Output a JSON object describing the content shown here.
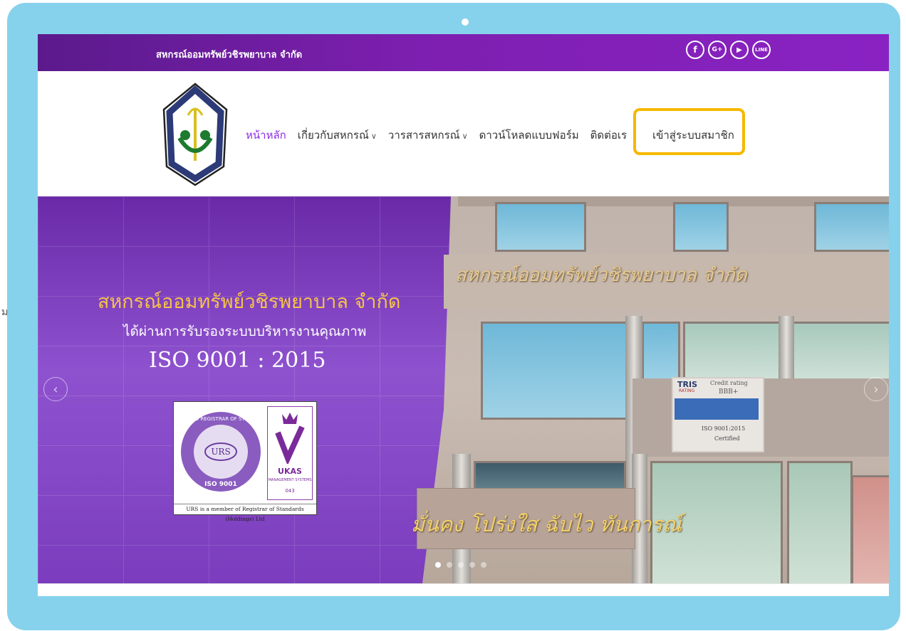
{
  "stray_char": "ม",
  "topbar": {
    "site_name": "สหกรณ์ออมทรัพย์วชิรพยาบาล จำกัด",
    "social_icons": [
      {
        "name": "facebook-icon",
        "glyph": "f"
      },
      {
        "name": "google-plus-icon",
        "glyph": "G+"
      },
      {
        "name": "youtube-icon",
        "glyph": "▶"
      },
      {
        "name": "line-icon",
        "glyph": "LINE"
      }
    ]
  },
  "nav": {
    "items": [
      {
        "label": "หน้าหลัก",
        "active": true,
        "dropdown": false
      },
      {
        "label": "เกี่ยวกับสหกรณ์",
        "dropdown": true
      },
      {
        "label": "วารสารสหกรณ์",
        "dropdown": true
      },
      {
        "label": "ดาวน์โหลดแบบฟอร์ม",
        "dropdown": false
      },
      {
        "label": "ติดต่อเร",
        "dropdown": false
      }
    ],
    "dropdown_glyph": "∨",
    "login_label": "เข้าสู่ระบบสมาชิก",
    "highlight_color": "#f6b800"
  },
  "logo": {
    "text": "สหกรณ์ออมทรัพย์วชิรพยาบาล จำกัด"
  },
  "hero": {
    "title": "สหกรณ์ออมทรัพย์วชิรพยาบาล จำกัด",
    "subtitle": "ได้ผ่านการรับรองระบบบริหารงานคุณภาพ",
    "iso": "ISO 9001 : 2015",
    "building_sign": "สหกรณ์ออมทรัพย์วชิรพยาบาล จำกัด",
    "building_slogan": "มั่นคง โปร่งใส ฉับไว ทันการณ์",
    "cert": {
      "urs_ring": "UNITED REGISTRAR OF SYSTEMS",
      "urs_center": "URS",
      "urs_iso": "ISO 9001",
      "ukas": "UKAS",
      "ukas_sub": "MANAGEMENT SYSTEMS",
      "ukas_num": "043",
      "footer": "URS is a member of Registrar of Standards (Holdings) Ltd"
    },
    "tris": {
      "logo": "TRIS",
      "logo_sub": "RATING",
      "rating_title": "Credit rating",
      "rating_value": "BBB+",
      "iso_line": "ISO 9001:2015",
      "certified": "Certified"
    },
    "prev_arrow": "‹",
    "next_arrow": "›",
    "slides": 5,
    "active_slide": 1
  }
}
